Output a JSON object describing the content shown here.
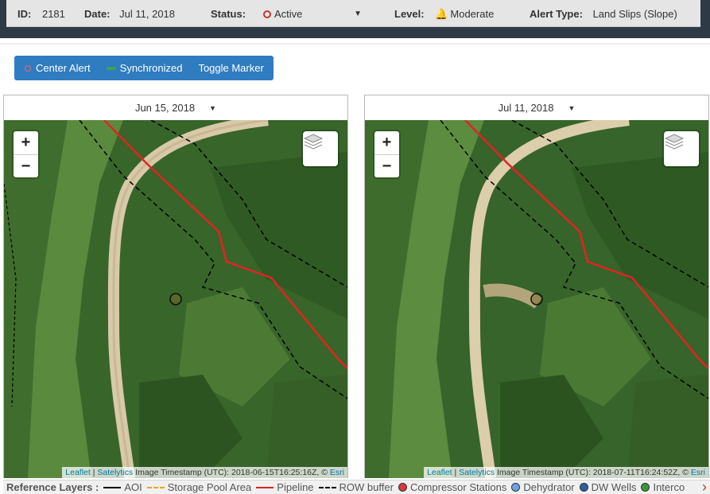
{
  "header": {
    "id_label": "ID:",
    "id_value": "2181",
    "date_label": "Date:",
    "date_value": "Jul 11, 2018",
    "status_label": "Status:",
    "status_value": "Active",
    "level_label": "Level:",
    "level_value": "Moderate",
    "type_label": "Alert Type:",
    "type_value": "Land Slips (Slope)",
    "status_color": "#c0392b",
    "level_color": "#f0a11a"
  },
  "toolbar": {
    "center_label": "Center Alert",
    "sync_label": "Synchronized",
    "toggle_label": "Toggle Marker",
    "bg_color": "#2f7cc1"
  },
  "maps": [
    {
      "date": "Jun 15, 2018",
      "zoom_in": "+",
      "zoom_out": "−",
      "attribution": {
        "leaflet": "Leaflet",
        "sep": " | ",
        "satelytics": "Satelytics",
        "timestamp": " Image Timestamp (UTC): 2018-06-15T16:25:16Z, © ",
        "esri": "Esri"
      }
    },
    {
      "date": "Jul 11, 2018",
      "zoom_in": "+",
      "zoom_out": "−",
      "attribution": {
        "leaflet": "Leaflet",
        "sep": " | ",
        "satelytics": "Satelytics",
        "timestamp": " Image Timestamp (UTC): 2018-07-11T16:24:52Z, © ",
        "esri": "Esri"
      }
    }
  ],
  "legend": {
    "title": "Reference Layers :",
    "items": [
      {
        "label": "AOI",
        "kind": "line",
        "color": "#000000",
        "style": "solid"
      },
      {
        "label": "Storage Pool Area",
        "kind": "line",
        "color": "#f0a11a",
        "style": "dashed"
      },
      {
        "label": "Pipeline",
        "kind": "line",
        "color": "#e02020",
        "style": "solid"
      },
      {
        "label": "ROW buffer",
        "kind": "line",
        "color": "#000000",
        "style": "dashed"
      },
      {
        "label": "Compressor Stations",
        "kind": "dot",
        "color": "#d63a3a"
      },
      {
        "label": "Dehydrator",
        "kind": "dot",
        "color": "#6aa3e8"
      },
      {
        "label": "DW Wells",
        "kind": "dot",
        "color": "#2c5f9e"
      },
      {
        "label": "Interco",
        "kind": "dot",
        "color": "#3a9a3a"
      }
    ]
  }
}
